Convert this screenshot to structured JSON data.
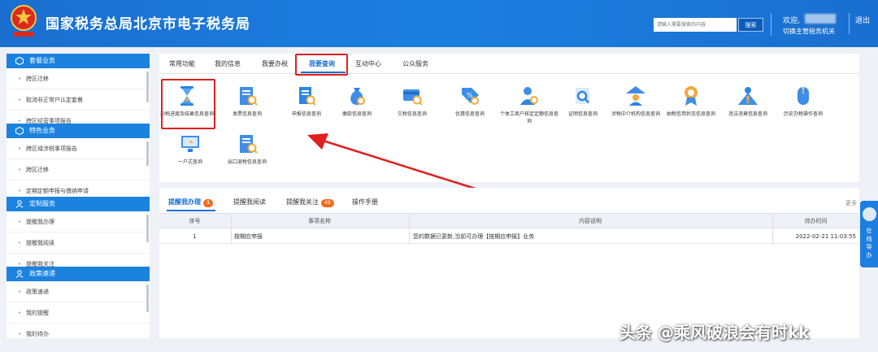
{
  "header": {
    "title": "国家税务总局北京市电子税务局",
    "search_placeholder": "请输入需要搜索的内容",
    "search_button": "搜索",
    "welcome": "欢迎,",
    "switch_authority": "切换主管税务机关",
    "logout": "退出"
  },
  "sidebar": {
    "sections": [
      {
        "title": "套餐业务",
        "items": [
          "跨区迁移",
          "取消非正常户认定套餐",
          "跨区经营事项报告"
        ]
      },
      {
        "title": "特色业务",
        "items": [
          "跨区域涉税事项报告",
          "跨区迁移",
          "定期定额申报与缴纳申请"
        ]
      },
      {
        "title": "定制服务",
        "items": [
          "提醒我办理",
          "提醒我阅读",
          "提醒我关注"
        ]
      },
      {
        "title": "政策速递",
        "items": [
          "政策速递",
          "我的提醒",
          "我的待办"
        ]
      }
    ]
  },
  "tabs": [
    "常用功能",
    "我的信息",
    "我要办税",
    "我要查询",
    "互动中心",
    "公众服务"
  ],
  "active_tab": "我要查询",
  "functions": [
    {
      "label": "办税进度及结果信息查询",
      "icon": "hourglass-icon"
    },
    {
      "label": "发票信息查询",
      "icon": "invoice-search-icon"
    },
    {
      "label": "申报信息查询",
      "icon": "declaration-search-icon"
    },
    {
      "label": "缴款信息查询",
      "icon": "money-bag-icon"
    },
    {
      "label": "欠税信息查询",
      "icon": "tax-owed-icon"
    },
    {
      "label": "优惠信息查询",
      "icon": "discount-tag-icon"
    },
    {
      "label": "个体工商户核定定额信息查询",
      "icon": "person-quota-icon"
    },
    {
      "label": "证明信息查询",
      "icon": "certificate-search-icon"
    },
    {
      "label": "涉税中介机构信息查询",
      "icon": "agency-icon"
    },
    {
      "label": "纳税信用状态信息查询",
      "icon": "credit-medal-icon"
    },
    {
      "label": "违法违章信息查询",
      "icon": "violation-icon"
    },
    {
      "label": "历史办税操作查询",
      "icon": "mouse-history-icon"
    },
    {
      "label": "一户式查询",
      "icon": "monitor-icon"
    },
    {
      "label": "出口退税信息查询",
      "icon": "export-refund-icon"
    }
  ],
  "bottom_tabs": [
    {
      "label": "提醒我办理",
      "badge": "1"
    },
    {
      "label": "提醒我阅读",
      "badge": ""
    },
    {
      "label": "提醒我关注",
      "badge": "49"
    },
    {
      "label": "操作手册",
      "badge": ""
    }
  ],
  "more": "更多",
  "table": {
    "columns": [
      "序号",
      "事项名称",
      "内容说明",
      "待办时间"
    ],
    "rows": [
      [
        "1",
        "按期应申报",
        "您的数据已更新,当前可办理【按期应申报】业务",
        "2022-02-21 11:03:55"
      ]
    ]
  },
  "float_nav": {
    "label": "在线导办"
  },
  "watermark": "头条 @乘风破浪会有时kk",
  "colors": {
    "primary": "#1a6fd0",
    "highlight": "#e02020",
    "badge": "#f26a1b"
  }
}
